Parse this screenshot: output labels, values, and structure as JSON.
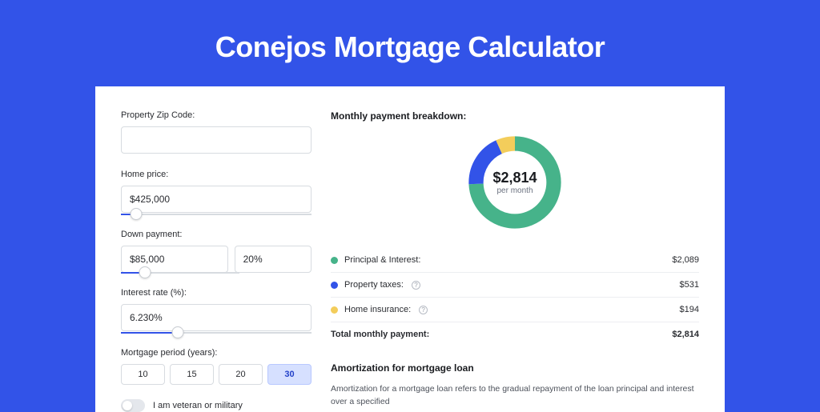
{
  "page_title": "Conejos Mortgage Calculator",
  "form": {
    "zip": {
      "label": "Property Zip Code:",
      "value": ""
    },
    "home_price": {
      "label": "Home price:",
      "value": "$425,000",
      "slider_pct": 8
    },
    "down_payment": {
      "label": "Down payment:",
      "amount": "$85,000",
      "percent": "20%",
      "slider_pct": 20
    },
    "interest_rate": {
      "label": "Interest rate (%):",
      "value": "6.230%",
      "slider_pct": 30
    },
    "period": {
      "label": "Mortgage period (years):",
      "options": [
        "10",
        "15",
        "20",
        "30"
      ],
      "active": "30"
    },
    "veteran": {
      "label": "I am veteran or military"
    }
  },
  "breakdown": {
    "heading": "Monthly payment breakdown:",
    "donut_amount": "$2,814",
    "donut_sub": "per month",
    "items": [
      {
        "label": "Principal & Interest:",
        "value": "$2,089",
        "color": "#46b38a",
        "info": false,
        "num": 2089
      },
      {
        "label": "Property taxes:",
        "value": "$531",
        "color": "#3253e8",
        "info": true,
        "num": 531
      },
      {
        "label": "Home insurance:",
        "value": "$194",
        "color": "#f3cd5b",
        "info": true,
        "num": 194
      }
    ],
    "total_label": "Total monthly payment:",
    "total_value": "$2,814"
  },
  "amortization": {
    "heading": "Amortization for mortgage loan",
    "body": "Amortization for a mortgage loan refers to the gradual repayment of the loan principal and interest over a specified"
  },
  "chart_data": {
    "type": "pie",
    "title": "Monthly payment breakdown",
    "series": [
      {
        "name": "Principal & Interest",
        "value": 2089,
        "color": "#46b38a"
      },
      {
        "name": "Property taxes",
        "value": 531,
        "color": "#3253e8"
      },
      {
        "name": "Home insurance",
        "value": 194,
        "color": "#f3cd5b"
      }
    ],
    "total": 2814,
    "center_label": "$2,814 per month"
  }
}
